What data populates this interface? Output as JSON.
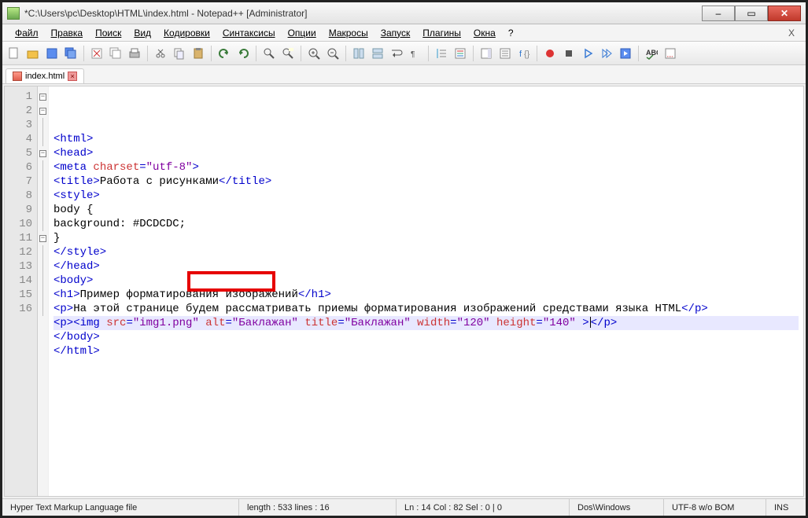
{
  "window": {
    "title": "*C:\\Users\\pc\\Desktop\\HTML\\index.html - Notepad++ [Administrator]"
  },
  "menu": {
    "items": [
      "Файл",
      "Правка",
      "Поиск",
      "Вид",
      "Кодировки",
      "Синтаксисы",
      "Опции",
      "Макросы",
      "Запуск",
      "Плагины",
      "Окна",
      "?"
    ]
  },
  "tab": {
    "label": "index.html"
  },
  "code": {
    "lines": [
      {
        "n": "1",
        "fold": "minus",
        "tokens": [
          {
            "t": "<html>",
            "c": "tag"
          }
        ]
      },
      {
        "n": "2",
        "fold": "minus",
        "tokens": [
          {
            "t": "<head>",
            "c": "tag"
          }
        ]
      },
      {
        "n": "3",
        "fold": "line",
        "tokens": [
          {
            "t": "<meta ",
            "c": "tag"
          },
          {
            "t": "charset",
            "c": "attr"
          },
          {
            "t": "=",
            "c": "tag"
          },
          {
            "t": "\"utf-8\"",
            "c": "str"
          },
          {
            "t": ">",
            "c": "tag"
          }
        ]
      },
      {
        "n": "4",
        "fold": "line",
        "tokens": [
          {
            "t": "<title>",
            "c": "tag"
          },
          {
            "t": "Работа с рисунками",
            "c": "txt"
          },
          {
            "t": "</title>",
            "c": "tag"
          }
        ]
      },
      {
        "n": "5",
        "fold": "minus",
        "tokens": [
          {
            "t": "<style>",
            "c": "tag"
          }
        ]
      },
      {
        "n": "6",
        "fold": "line",
        "tokens": [
          {
            "t": "body {",
            "c": "txt"
          }
        ]
      },
      {
        "n": "7",
        "fold": "line",
        "tokens": [
          {
            "t": "background: #DCDCDC;",
            "c": "txt"
          }
        ]
      },
      {
        "n": "8",
        "fold": "line",
        "tokens": [
          {
            "t": "}",
            "c": "txt"
          }
        ]
      },
      {
        "n": "9",
        "fold": "end",
        "tokens": [
          {
            "t": "</style>",
            "c": "tag"
          }
        ]
      },
      {
        "n": "10",
        "fold": "end",
        "tokens": [
          {
            "t": "</head>",
            "c": "tag"
          }
        ]
      },
      {
        "n": "11",
        "fold": "minus",
        "tokens": [
          {
            "t": "<body>",
            "c": "tag"
          }
        ]
      },
      {
        "n": "12",
        "fold": "line",
        "tokens": [
          {
            "t": "<h1>",
            "c": "tag"
          },
          {
            "t": "Пример форматирования изображений",
            "c": "txt"
          },
          {
            "t": "</h1>",
            "c": "tag"
          }
        ]
      },
      {
        "n": "13",
        "fold": "line",
        "tokens": [
          {
            "t": "<p>",
            "c": "tag"
          },
          {
            "t": "На этой странице будем рассматривать приемы форматирования изображений средствами языка HTML",
            "c": "txt"
          },
          {
            "t": "</p>",
            "c": "tag"
          }
        ]
      },
      {
        "n": "14",
        "fold": "line",
        "hl": true,
        "tokens": [
          {
            "t": "<p><img ",
            "c": "tag"
          },
          {
            "t": "src",
            "c": "attr"
          },
          {
            "t": "=",
            "c": "tag"
          },
          {
            "t": "\"img1.png\"",
            "c": "str"
          },
          {
            "t": " ",
            "c": "tag"
          },
          {
            "t": "alt",
            "c": "attr"
          },
          {
            "t": "=",
            "c": "tag"
          },
          {
            "t": "\"Баклажан\"",
            "c": "str"
          },
          {
            "t": " ",
            "c": "tag"
          },
          {
            "t": "title",
            "c": "attr"
          },
          {
            "t": "=",
            "c": "tag"
          },
          {
            "t": "\"Баклажан\"",
            "c": "str"
          },
          {
            "t": " ",
            "c": "tag"
          },
          {
            "t": "width",
            "c": "attr"
          },
          {
            "t": "=",
            "c": "tag"
          },
          {
            "t": "\"120\"",
            "c": "str"
          },
          {
            "t": " ",
            "c": "tag"
          },
          {
            "t": "height",
            "c": "attr"
          },
          {
            "t": "=",
            "c": "tag"
          },
          {
            "t": "\"140\"",
            "c": "str"
          },
          {
            "t": " >",
            "c": "tag"
          },
          {
            "cursor": true
          },
          {
            "t": "</p>",
            "c": "tag"
          }
        ]
      },
      {
        "n": "15",
        "fold": "end",
        "tokens": [
          {
            "t": "</body>",
            "c": "tag"
          }
        ]
      },
      {
        "n": "16",
        "fold": "end",
        "tokens": [
          {
            "t": "</html>",
            "c": "tag"
          }
        ]
      }
    ]
  },
  "highlight_box": {
    "top_line": 14,
    "text": "alt=\"Баклажан\""
  },
  "status": {
    "lang": "Hyper Text Markup Language file",
    "length": "length : 533    lines : 16",
    "pos": "Ln : 14    Col : 82    Sel : 0 | 0",
    "eol": "Dos\\Windows",
    "enc": "UTF-8 w/o BOM",
    "mode": "INS"
  },
  "icons": {
    "new": "#fff",
    "open": "#f3c24a",
    "save": "#5b8def",
    "saveall": "#5b8def",
    "print": "#888",
    "cut": "#888",
    "copy": "#bde",
    "paste": "#bde",
    "undo": "#5a5",
    "redo": "#5a5",
    "find": "#88f",
    "replace": "#88f",
    "zoomin": "#888",
    "zoomout": "#888",
    "wrap": "#888",
    "rec": "#d33",
    "stop": "#555",
    "play": "#3a7bd5"
  }
}
